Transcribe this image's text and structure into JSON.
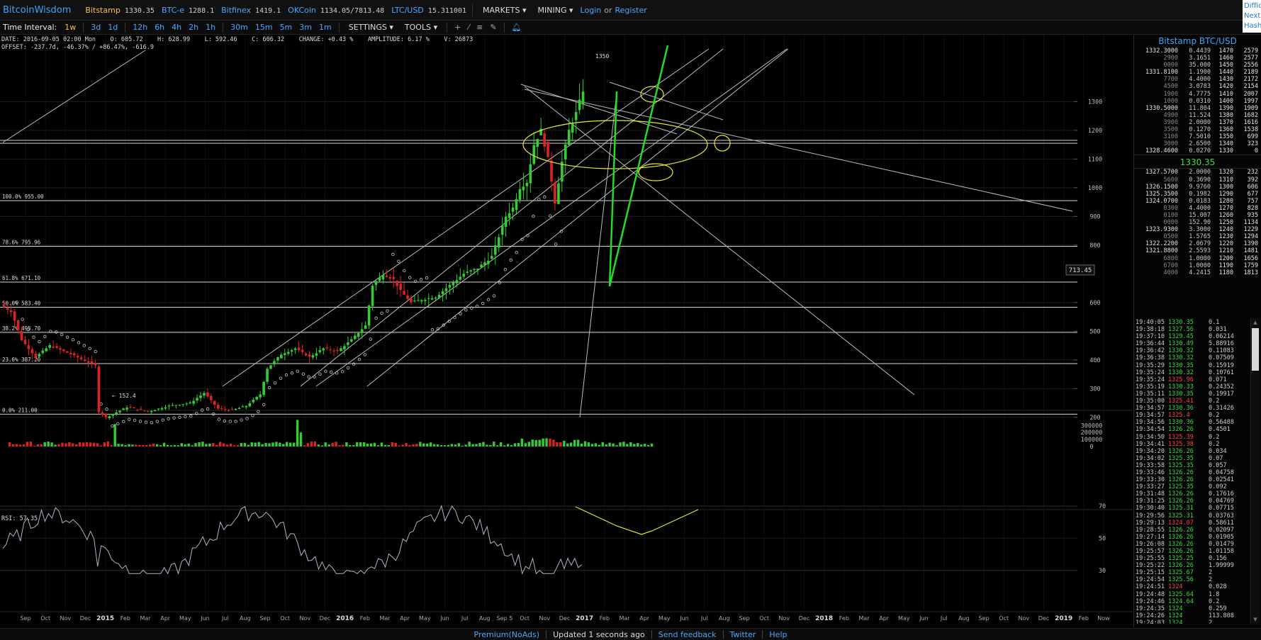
{
  "nav": {
    "brand": "BitcoinWisdom",
    "markets": [
      {
        "name": "Bitstamp",
        "price": "1330.35",
        "active": true
      },
      {
        "name": "BTC-e",
        "price": "1288.1"
      },
      {
        "name": "Bitfinex",
        "price": "1419.1"
      },
      {
        "name": "OKCoin",
        "price": "1134.05/7813.48"
      },
      {
        "name": "LTC/USD",
        "price": "15.311001"
      }
    ],
    "markets_menu": "MARKETS",
    "mining_menu": "MINING",
    "login": "Login",
    "or": "or",
    "register": "Register"
  },
  "corner_panel": [
    "Diffic",
    "Next",
    "Hash"
  ],
  "toolbar": {
    "time_interval_label": "Time Interval:",
    "intervals": [
      "1w",
      "3d",
      "1d",
      "12h",
      "6h",
      "4h",
      "2h",
      "1h",
      "30m",
      "15m",
      "5m",
      "3m",
      "1m"
    ],
    "selected_interval": "1w",
    "settings": "SETTINGS",
    "tools": "TOOLS"
  },
  "ohlc": {
    "line1": "DATE: 2016-09-05 02:00 Mon    O: 605.72    H: 628.99    L: 592.46    C: 606.32    CHANGE: +0.43 %    AMPLITUDE: 6.17 %    V: 26873",
    "line2": "OFFSET: -237.7d, -46.37% / +86.47%, -616.9"
  },
  "chart_data": {
    "type": "candlestick",
    "price_axis": [
      "1300",
      "1200",
      "1100",
      "1000",
      "900",
      "800",
      "600",
      "500",
      "400",
      "300",
      "200"
    ],
    "price_tag": "713.45",
    "high_label": "1350",
    "low_label": "152.4",
    "fib_levels": [
      {
        "label": "100.0% 955.00",
        "value": 955
      },
      {
        "label": "78.6% 795.96",
        "value": 795.96
      },
      {
        "label": "61.8% 671.10",
        "value": 671.1
      },
      {
        "label": "50.0% 583.40",
        "value": 583.4
      },
      {
        "label": "38.2% 495.70",
        "value": 495.7
      },
      {
        "label": "23.6% 387.20",
        "value": 387.2
      },
      {
        "label": "0.0% 211.00",
        "value": 211
      }
    ],
    "volume_axis": [
      "300000",
      "200000",
      "100000",
      "0"
    ],
    "rsi_label": "RSI: 57.35",
    "rsi_axis": [
      "70",
      "50",
      "30"
    ],
    "time_axis": [
      "Sep",
      "Oct",
      "Nov",
      "Dec",
      "2015",
      "Feb",
      "Mar",
      "Apr",
      "May",
      "Jun",
      "Jul",
      "Aug",
      "Sep",
      "Oct",
      "Nov",
      "Dec",
      "2016",
      "Feb",
      "Mar",
      "Apr",
      "May",
      "Jun",
      "Jul",
      "Aug",
      "Sep 5",
      "Oct",
      "Nov",
      "Dec",
      "2017",
      "Feb",
      "Mar",
      "Apr",
      "May",
      "Jun",
      "Jul",
      "Aug",
      "Sep",
      "Oct",
      "Nov",
      "Dec",
      "2018",
      "Feb",
      "Mar",
      "Apr",
      "May",
      "Jun",
      "Jul",
      "Aug",
      "Sep",
      "Oct",
      "Nov",
      "Dec",
      "2019",
      "Feb",
      "Now"
    ],
    "colors": {
      "up": "#33cc33",
      "down": "#dd2222",
      "grid": "#1e1e1e",
      "line": "#bdbdbd",
      "yellow": "#e8e830",
      "green": "#22dd22"
    }
  },
  "orderbook": {
    "title": "Bitstamp BTC/USD",
    "asks": [
      [
        "1332.3000",
        "0.4439",
        "1470",
        "2579"
      ],
      [
        "2900",
        "3.1651",
        "1460",
        "2577"
      ],
      [
        "0000",
        "35.000",
        "1450",
        "2556"
      ],
      [
        "1331.8100",
        "1.1900",
        "1440",
        "2189"
      ],
      [
        "7700",
        "4.4000",
        "1430",
        "2172"
      ],
      [
        "4500",
        "3.0783",
        "1420",
        "2154"
      ],
      [
        "1900",
        "4.7775",
        "1410",
        "2007"
      ],
      [
        "1000",
        "0.0310",
        "1400",
        "1997"
      ],
      [
        "1330.5000",
        "11.804",
        "1390",
        "1909"
      ],
      [
        "4900",
        "11.524",
        "1380",
        "1682"
      ],
      [
        "3900",
        "2.0000",
        "1370",
        "1616"
      ],
      [
        "3500",
        "0.1270",
        "1360",
        "1538"
      ],
      [
        "3100",
        "7.5010",
        "1350",
        "699"
      ],
      [
        "3000",
        "2.6500",
        "1340",
        "323"
      ],
      [
        "1328.4600",
        "0.0270",
        "1330",
        "0"
      ]
    ],
    "last": "1330.35",
    "bids": [
      [
        "1327.5700",
        "2.0000",
        "1320",
        "232"
      ],
      [
        "5600",
        "0.3690",
        "1310",
        "392"
      ],
      [
        "1326.1500",
        "9.9760",
        "1300",
        "606"
      ],
      [
        "1325.3500",
        "0.1982",
        "1290",
        "677"
      ],
      [
        "1324.0700",
        "0.0183",
        "1280",
        "757"
      ],
      [
        "0300",
        "4.4000",
        "1270",
        "828"
      ],
      [
        "0100",
        "15.007",
        "1260",
        "935"
      ],
      [
        "0000",
        "152.90",
        "1250",
        "1134"
      ],
      [
        "1323.9300",
        "3.3000",
        "1240",
        "1229"
      ],
      [
        "0500",
        "1.5765",
        "1230",
        "1294"
      ],
      [
        "1322.2200",
        "2.0679",
        "1220",
        "1390"
      ],
      [
        "1321.8800",
        "2.5593",
        "1210",
        "1481"
      ],
      [
        "6800",
        "1.0000",
        "1200",
        "1656"
      ],
      [
        "6700",
        "1.0000",
        "1190",
        "1759"
      ],
      [
        "4000",
        "4.2415",
        "1180",
        "1813"
      ]
    ]
  },
  "trades": [
    [
      "19:40:05",
      "1330.35",
      "0.1",
      "up"
    ],
    [
      "19:38:18",
      "1327.56",
      "0.031",
      "up"
    ],
    [
      "19:37:10",
      "1329.45",
      "0.06214",
      "up"
    ],
    [
      "19:36:44",
      "1330.49",
      "5.88916",
      "up"
    ],
    [
      "19:36:42",
      "1330.32",
      "0.11083",
      "up"
    ],
    [
      "19:36:38",
      "1330.32",
      "0.07509",
      "up"
    ],
    [
      "19:35:29",
      "1330.35",
      "0.15919",
      "up"
    ],
    [
      "19:35:24",
      "1330.32",
      "0.10761",
      "up"
    ],
    [
      "19:35:24",
      "1325.96",
      "0.071",
      "dn"
    ],
    [
      "19:35:19",
      "1330.33",
      "0.24352",
      "up"
    ],
    [
      "19:35:11",
      "1330.35",
      "0.19917",
      "up"
    ],
    [
      "19:35:00",
      "1325.41",
      "0.2",
      "dn"
    ],
    [
      "19:34:57",
      "1330.36",
      "0.31426",
      "up"
    ],
    [
      "19:34:57",
      "1325.4",
      "0.2",
      "dn"
    ],
    [
      "19:34:56",
      "1330.36",
      "0.56488",
      "up"
    ],
    [
      "19:34:54",
      "1326.26",
      "0.4501",
      "up"
    ],
    [
      "19:34:50",
      "1325.39",
      "0.2",
      "dn"
    ],
    [
      "19:34:41",
      "1325.38",
      "0.2",
      "dn"
    ],
    [
      "19:34:20",
      "1326.26",
      "0.034",
      "up"
    ],
    [
      "19:34:02",
      "1325.35",
      "0.07",
      "up"
    ],
    [
      "19:33:58",
      "1325.35",
      "0.057",
      "up"
    ],
    [
      "19:33:46",
      "1326.26",
      "0.04758",
      "up"
    ],
    [
      "19:33:30",
      "1326.26",
      "0.02541",
      "up"
    ],
    [
      "19:33:27",
      "1325.35",
      "0.092",
      "up"
    ],
    [
      "19:31:48",
      "1326.26",
      "0.17616",
      "up"
    ],
    [
      "19:31:25",
      "1326.26",
      "0.04769",
      "up"
    ],
    [
      "19:30:40",
      "1325.31",
      "0.07715",
      "up"
    ],
    [
      "19:29:56",
      "1325.31",
      "0.03763",
      "up"
    ],
    [
      "19:29:13",
      "1324.07",
      "0.58611",
      "dn"
    ],
    [
      "19:28:55",
      "1326.26",
      "0.02097",
      "up"
    ],
    [
      "19:27:14",
      "1326.26",
      "0.01905",
      "up"
    ],
    [
      "19:26:08",
      "1326.26",
      "0.01479",
      "up"
    ],
    [
      "19:25:57",
      "1326.26",
      "1.01158",
      "up"
    ],
    [
      "19:25:55",
      "1325.25",
      "0.156",
      "up"
    ],
    [
      "19:25:22",
      "1326.26",
      "1.99999",
      "up"
    ],
    [
      "19:25:15",
      "1325.67",
      "2",
      "up"
    ],
    [
      "19:24:54",
      "1325.56",
      "2",
      "up"
    ],
    [
      "19:24:51",
      "1324",
      "0.028",
      "dn"
    ],
    [
      "19:24:48",
      "1325.64",
      "1.8",
      "up"
    ],
    [
      "19:24:46",
      "1324.64",
      "0.2",
      "up"
    ],
    [
      "19:24:35",
      "1324",
      "0.259",
      "up"
    ],
    [
      "19:24:26",
      "1324",
      "113.808",
      "up"
    ],
    [
      "19:24:03",
      "1324",
      "2",
      "up"
    ],
    [
      "19:24:03",
      "1324",
      "2",
      "up"
    ]
  ],
  "footer": {
    "premium": "Premium(NoAds)",
    "updated": "Updated 1 seconds ago",
    "feedback": "Send feedback",
    "twitter": "Twitter",
    "help": "Help"
  }
}
